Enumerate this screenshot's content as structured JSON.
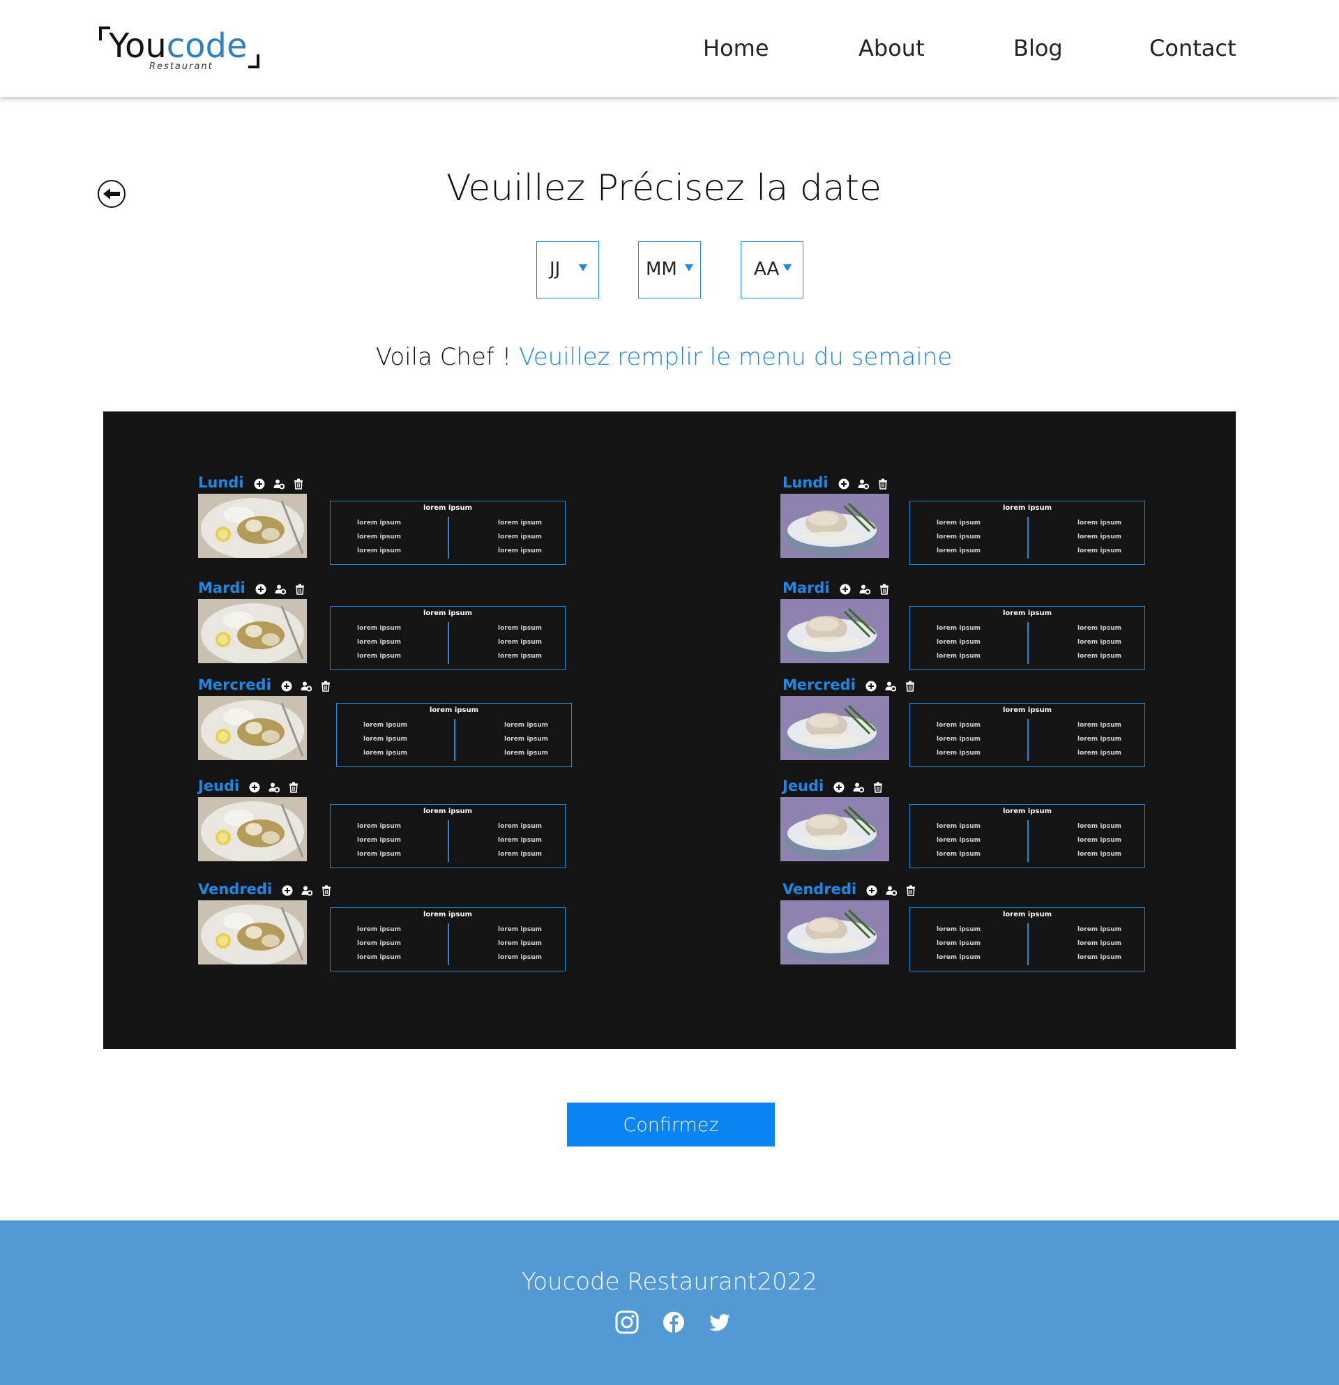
{
  "header": {
    "logo_main": "You",
    "logo_accent": "code",
    "logo_sub": "Restaurant",
    "nav": [
      "Home",
      "About",
      "Blog",
      "Contact"
    ]
  },
  "page": {
    "title": "Veuillez Précisez la date",
    "selects": {
      "day": "JJ",
      "month": "MM",
      "year": "AA"
    },
    "subtitle_prefix": "Voila Chef ! ",
    "subtitle_accent": "Veuillez remplir le menu du semaine",
    "confirm_label": "Confirmez"
  },
  "menu": {
    "left": [
      {
        "day": "Lundi"
      },
      {
        "day": "Mardi"
      },
      {
        "day": "Mercredi"
      },
      {
        "day": "Jeudi"
      },
      {
        "day": "Vendredi"
      }
    ],
    "right": [
      {
        "day": "Lundi"
      },
      {
        "day": "Mardi"
      },
      {
        "day": "Mercredi"
      },
      {
        "day": "Jeudi"
      },
      {
        "day": "Vendredi"
      }
    ],
    "card_title": "lorem ipsum",
    "card_item": "lorem ipsum",
    "icons": [
      "plus-circle-icon",
      "user-gear-icon",
      "trash-icon"
    ]
  },
  "footer": {
    "text": "Youcode Restaurant2022",
    "social": [
      "instagram-icon",
      "facebook-icon",
      "twitter-icon"
    ]
  },
  "colors": {
    "accent": "#1e88e5",
    "button": "#0a84f0",
    "footer": "#5399d4",
    "panel": "#141414"
  }
}
